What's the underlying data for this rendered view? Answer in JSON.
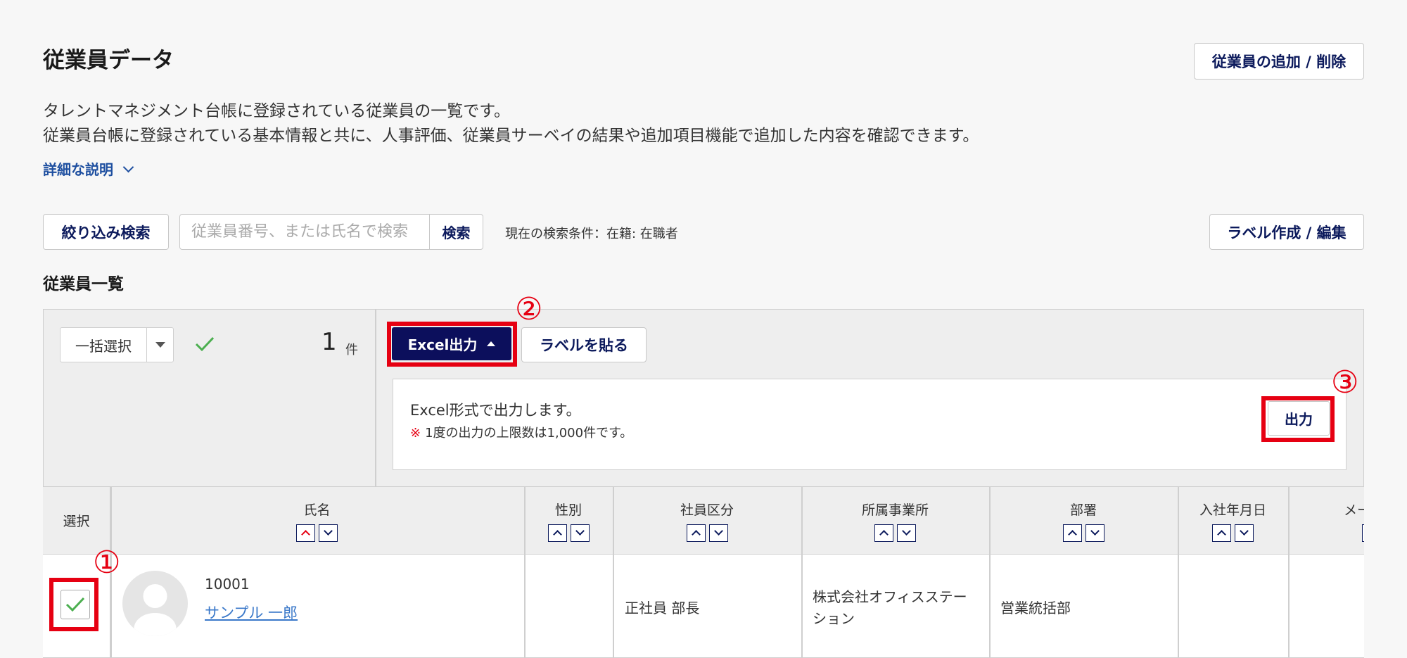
{
  "page": {
    "title": "従業員データ",
    "add_remove_button": "従業員の追加 / 削除",
    "description_line1": "タレントマネジメント台帳に登録されている従業員の一覧です。",
    "description_line2": "従業員台帳に登録されている基本情報と共に、人事評価、従業員サーベイの結果や追加項目機能で追加した内容を確認できます。",
    "detail_link": "詳細な説明"
  },
  "search": {
    "filter_button": "絞り込み検索",
    "placeholder": "従業員番号、または氏名で検索",
    "search_button": "検索",
    "current_condition": "現在の検索条件：在籍: 在職者",
    "label_edit_button": "ラベル作成 / 編集"
  },
  "list": {
    "title": "従業員一覧",
    "bulk_select": "一括選択",
    "selected_count": "1",
    "count_unit": "件",
    "excel_button": "Excel出力",
    "paste_label_button": "ラベルを貼る",
    "export_message": "Excel形式で出力します。",
    "export_note_mark": "※",
    "export_note": "1度の出力の上限数は1,000件です。",
    "output_button": "出力"
  },
  "annotations": {
    "step1": "①",
    "step2": "②",
    "step3": "③"
  },
  "table": {
    "headers": {
      "select": "選択",
      "name": "氏名",
      "gender": "性別",
      "employee_type": "社員区分",
      "office": "所属事業所",
      "department": "部署",
      "hire_date": "入社年月日",
      "email": "メール"
    },
    "rows": [
      {
        "employee_no": "10001",
        "name": "サンプル 一郎",
        "gender": "",
        "employee_type": "正社員 部長",
        "office_line1": "株式会社オフィスステー",
        "office_line2": "ション",
        "department": "営業統括部",
        "hire_date": ""
      }
    ]
  },
  "colors": {
    "primary": "#0c0f5c",
    "accent_red": "#e60012",
    "link": "#3a78c9",
    "check_green": "#4caf50"
  }
}
